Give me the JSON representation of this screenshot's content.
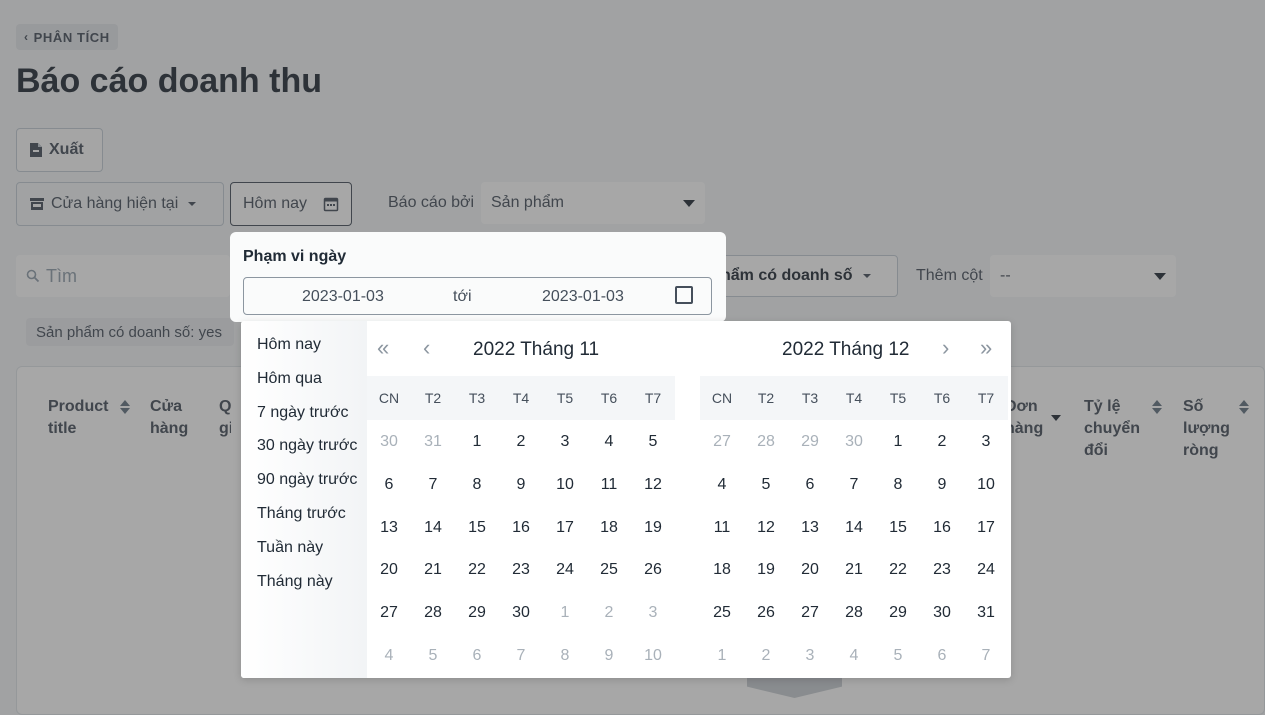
{
  "header": {
    "back_label": "PHÂN TÍCH",
    "title": "Báo cáo doanh thu"
  },
  "toolbar": {
    "export_label": "Xuất",
    "store_label": "Cửa hàng hiện tại",
    "date_label": "Hôm nay",
    "report_by_label": "Báo cáo bởi",
    "report_by_value": "Sản phẩm"
  },
  "filters": {
    "search_placeholder": "Tìm",
    "sales_filter_label": "hẩm có doanh số",
    "add_column_label": "Thêm cột",
    "add_column_value": "--",
    "active_chip": "Sản phẩm có doanh số: yes"
  },
  "table": {
    "columns": [
      {
        "label": "Product title"
      },
      {
        "label": "Cửa hàng"
      },
      {
        "label": "Q gia"
      },
      {
        "label": "Đơn hàng"
      },
      {
        "label": "Tỷ lệ chuyển đổi"
      },
      {
        "label": "Số lượng ròng"
      }
    ]
  },
  "date_range": {
    "title": "Phạm vi ngày",
    "from": "2023-01-03",
    "separator": "tới",
    "to": "2023-01-03"
  },
  "presets": [
    "Hôm nay",
    "Hôm qua",
    "7 ngày trước",
    "30 ngày trước",
    "90 ngày trước",
    "Tháng trước",
    "Tuần này",
    "Tháng này"
  ],
  "calendar": {
    "weekdays": [
      "CN",
      "T2",
      "T3",
      "T4",
      "T5",
      "T6",
      "T7"
    ],
    "nav": {
      "prev_year": "«",
      "prev_month": "‹",
      "next_month": "›",
      "next_year": "»"
    },
    "months": [
      {
        "title": "2022 Tháng 11",
        "days": [
          [
            "30",
            "31",
            "1",
            "2",
            "3",
            "4",
            "5"
          ],
          [
            "6",
            "7",
            "8",
            "9",
            "10",
            "11",
            "12"
          ],
          [
            "13",
            "14",
            "15",
            "16",
            "17",
            "18",
            "19"
          ],
          [
            "20",
            "21",
            "22",
            "23",
            "24",
            "25",
            "26"
          ],
          [
            "27",
            "28",
            "29",
            "30",
            "1",
            "2",
            "3"
          ],
          [
            "4",
            "5",
            "6",
            "7",
            "8",
            "9",
            "10"
          ]
        ],
        "outside_first_row": 2,
        "outside_after_row": 4,
        "outside_after_col": 4
      },
      {
        "title": "2022 Tháng 12",
        "days": [
          [
            "27",
            "28",
            "29",
            "30",
            "1",
            "2",
            "3"
          ],
          [
            "4",
            "5",
            "6",
            "7",
            "8",
            "9",
            "10"
          ],
          [
            "11",
            "12",
            "13",
            "14",
            "15",
            "16",
            "17"
          ],
          [
            "18",
            "19",
            "20",
            "21",
            "22",
            "23",
            "24"
          ],
          [
            "25",
            "26",
            "27",
            "28",
            "29",
            "30",
            "31"
          ],
          [
            "1",
            "2",
            "3",
            "4",
            "5",
            "6",
            "7"
          ]
        ],
        "outside_first_row": 4,
        "outside_after_row": 5,
        "outside_after_col": 0
      }
    ]
  },
  "colors": {
    "overlay": "rgba(60,60,60,0.45)",
    "text_primary": "#212b36",
    "text_muted": "#a9b1b9"
  }
}
